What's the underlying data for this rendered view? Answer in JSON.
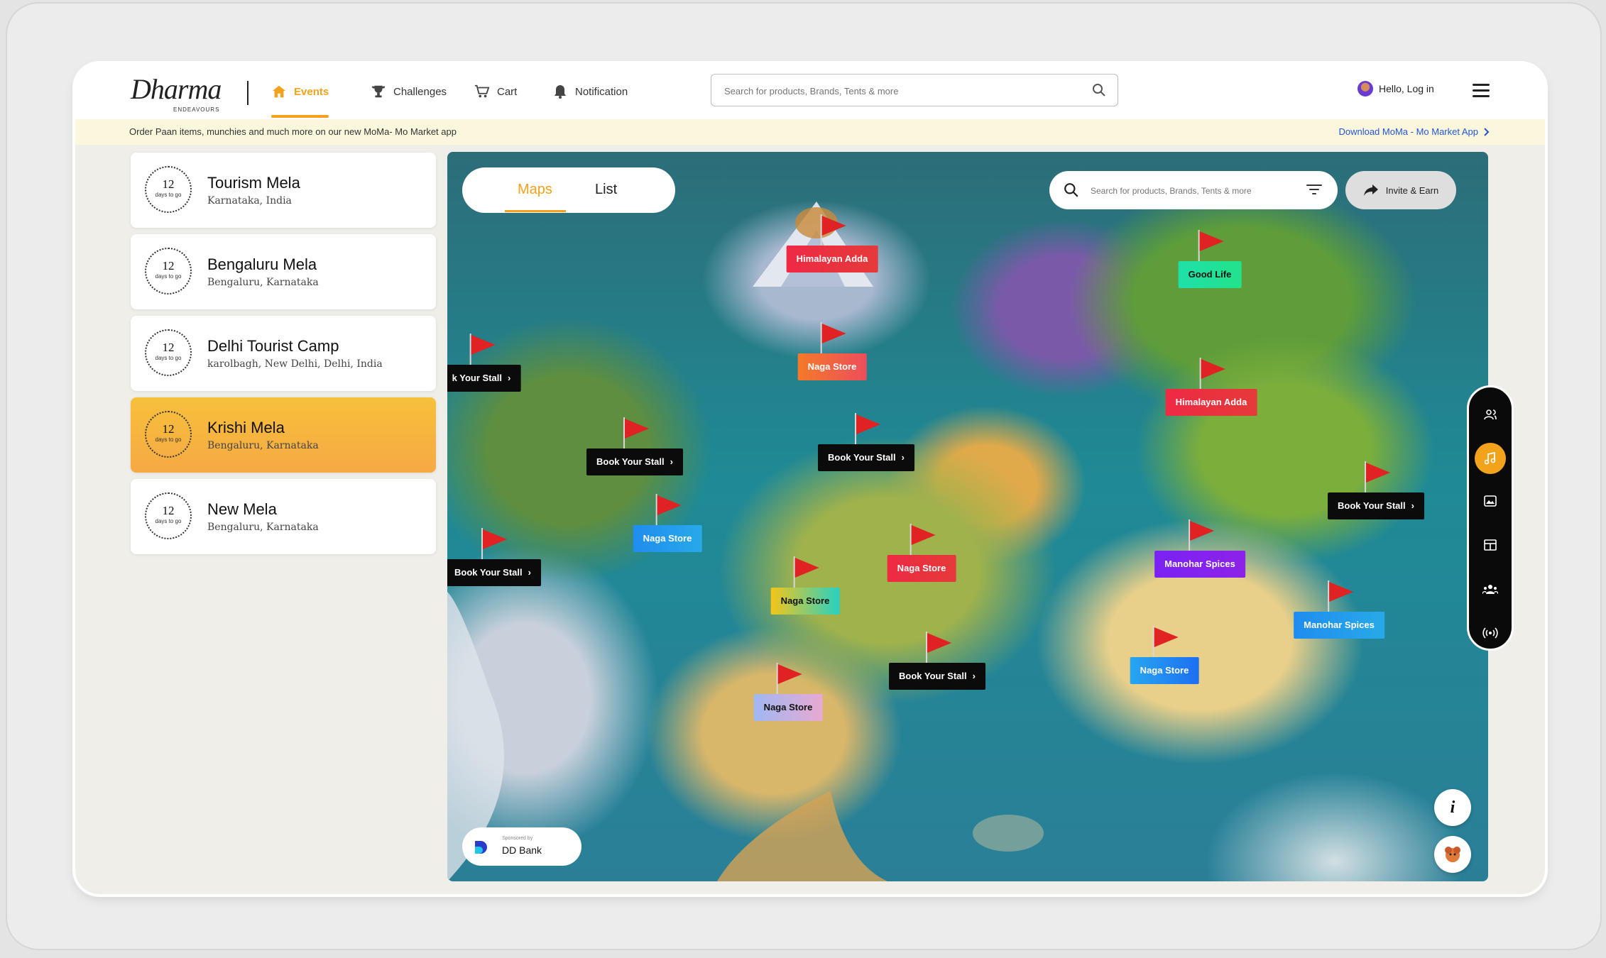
{
  "logo": {
    "name": "Dharma",
    "tagline": "ENDEAVOURS"
  },
  "nav": [
    {
      "label": "Events",
      "icon": "home-icon",
      "active": true
    },
    {
      "label": "Challenges",
      "icon": "trophy-icon"
    },
    {
      "label": "Cart",
      "icon": "cart-icon"
    },
    {
      "label": "Notification",
      "icon": "bell-icon"
    }
  ],
  "search": {
    "placeholder": "Search for products, Brands, Tents & more"
  },
  "user": {
    "login_label": "Hello, Log in"
  },
  "banner": {
    "text": "Order Paan items, munchies and much more on our new MoMa- Mo Market app",
    "link": "Download MoMa - Mo Market App"
  },
  "events": [
    {
      "days": "12",
      "days_label": "days to go",
      "title": "Tourism Mela",
      "location": "Karnataka, India"
    },
    {
      "days": "12",
      "days_label": "days to go",
      "title": "Bengaluru Mela",
      "location": "Bengaluru, Karnataka"
    },
    {
      "days": "12",
      "days_label": "days to go",
      "title": "Delhi Tourist Camp",
      "location": "karolbagh, New Delhi, Delhi, India"
    },
    {
      "days": "12",
      "days_label": "days to go",
      "title": "Krishi Mela",
      "location": "Bengaluru, Karnataka",
      "active": true
    },
    {
      "days": "12",
      "days_label": "days to go",
      "title": "New Mela",
      "location": "Bengaluru, Karnataka"
    }
  ],
  "map": {
    "tabs": {
      "maps": "Maps",
      "list": "List"
    },
    "search_placeholder": "Search for products, Brands, Tents & more",
    "invite_label": "Invite & Earn",
    "sponsor": {
      "by": "Sponsored by",
      "name": "DD Bank"
    },
    "pins": [
      {
        "label": "Himalayan Adda",
        "style": "g-red"
      },
      {
        "label": "Good Life",
        "style": "g-green"
      },
      {
        "label": "k Your Stall",
        "style": "black"
      },
      {
        "label": "Naga Store",
        "style": "g-orange"
      },
      {
        "label": "Himalayan Adda",
        "style": "g-red"
      },
      {
        "label": "Book Your Stall",
        "style": "black"
      },
      {
        "label": "Book Your Stall",
        "style": "black"
      },
      {
        "label": "Book Your Stall",
        "style": "black"
      },
      {
        "label": "Naga Store",
        "style": "g-blue"
      },
      {
        "label": "Naga Store",
        "style": "g-red"
      },
      {
        "label": "Manohar Spices",
        "style": "g-purple"
      },
      {
        "label": "Book Your Stall",
        "style": "black"
      },
      {
        "label": "Naga Store",
        "style": "g-yellow"
      },
      {
        "label": "Manohar Spices",
        "style": "g-blue"
      },
      {
        "label": "Naga Store",
        "style": "g-bluedeep"
      },
      {
        "label": "Book Your Stall",
        "style": "black"
      },
      {
        "label": "Naga Store",
        "style": "g-pink"
      }
    ]
  },
  "toolbar": [
    "user-group-icon",
    "music-icon",
    "image-icon",
    "layout-icon",
    "community-icon",
    "broadcast-icon"
  ],
  "colors": {
    "accent": "#f2a21b",
    "link": "#2255d6",
    "banner": "#fbf7dc"
  }
}
